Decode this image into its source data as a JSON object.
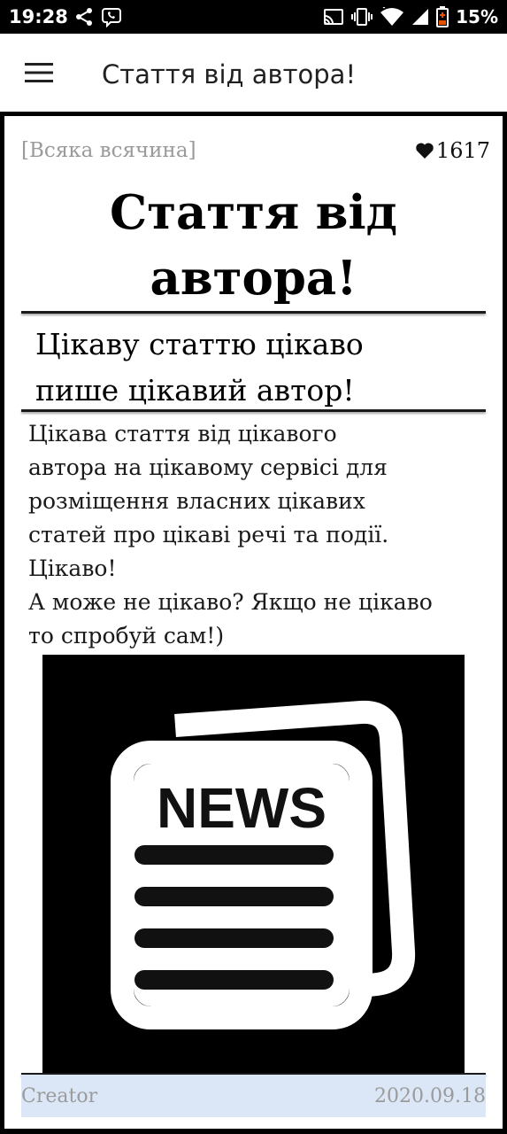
{
  "status_bar": {
    "time": "19:28",
    "left_icons": [
      "share-icon",
      "viber-icon"
    ],
    "right_icons": [
      "cast-icon",
      "vibrate-icon",
      "wifi-icon",
      "signal-icon",
      "battery-icon"
    ],
    "battery_percent": "15%",
    "battery_color": "#e65100"
  },
  "app_bar": {
    "menu_icon": "hamburger-menu-icon",
    "title": "Стаття від автора!"
  },
  "article": {
    "category": "[Всяка всячина]",
    "likes_icon": "heart-icon",
    "likes": "1617",
    "title_lines": [
      "Стаття від",
      "автора!"
    ],
    "subtitle_lines": [
      "Цікаву статтю цікаво",
      "пише цікавий автор!"
    ],
    "body_lines": [
      "Цікава стаття від цікавого",
      "автора на цікавому сервісі для",
      "розміщення власних цікавих",
      "статей про цікаві речі та події.",
      "Цікаво!",
      "А може не цікаво? Якщо не цікаво",
      "то спробуй сам!)"
    ],
    "image": {
      "icon": "news-icon",
      "label": "NEWS"
    },
    "footer": {
      "author": "Creator",
      "date": "2020.09.18",
      "background": "#dbe6f6"
    }
  }
}
